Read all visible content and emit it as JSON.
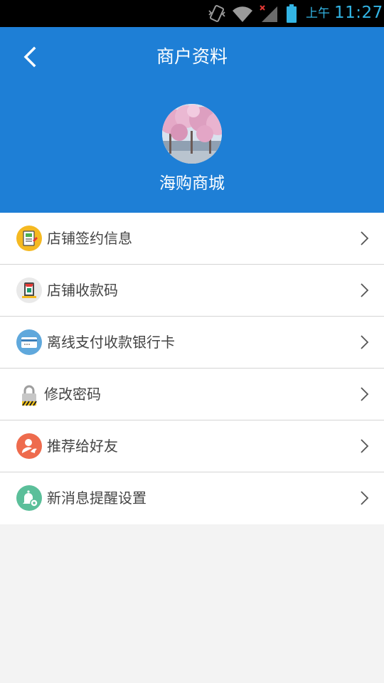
{
  "status_bar": {
    "ampm": "上午",
    "time": "11:27",
    "icons": [
      "vibrate-icon",
      "wifi-icon",
      "signal-icon",
      "battery-icon"
    ],
    "accent_color": "#33b5e5"
  },
  "header": {
    "title": "商户资料",
    "shop_name": "海购商城",
    "background_color": "#1e7fd6"
  },
  "menu": {
    "items": [
      {
        "label": "店铺签约信息",
        "icon": "contract-doc-icon"
      },
      {
        "label": "店铺收款码",
        "icon": "shop-qrcode-icon"
      },
      {
        "label": "离线支付收款银行卡",
        "icon": "bank-card-icon"
      },
      {
        "label": "修改密码",
        "icon": "lock-icon"
      },
      {
        "label": "推荐给好友",
        "icon": "recommend-friend-icon"
      },
      {
        "label": "新消息提醒设置",
        "icon": "notification-bell-icon"
      }
    ]
  }
}
